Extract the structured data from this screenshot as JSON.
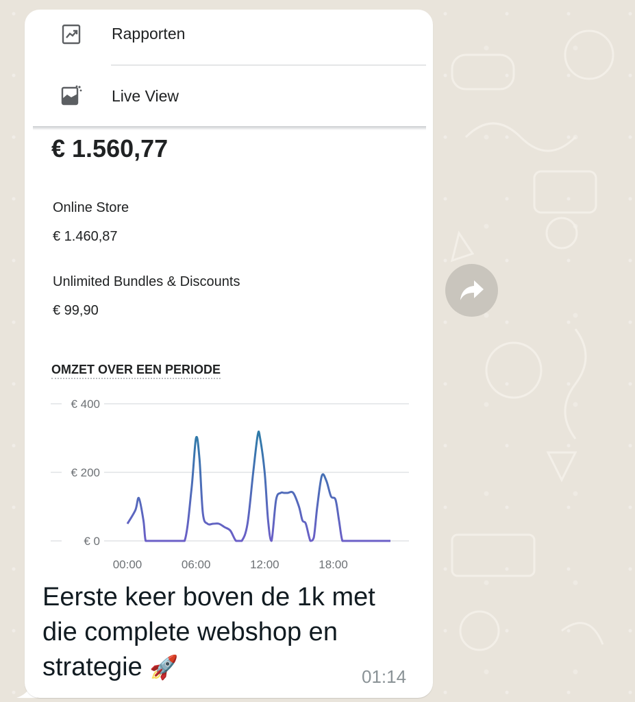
{
  "menu": {
    "items": [
      {
        "label": "Rapporten",
        "icon": "report-chart-icon"
      },
      {
        "label": "Live View",
        "icon": "live-view-icon"
      }
    ]
  },
  "summary": {
    "total": "€ 1.560,77",
    "sources": [
      {
        "name": "Online Store",
        "value": "€ 1.460,87"
      },
      {
        "name": "Unlimited Bundles & Discounts",
        "value": "€ 99,90"
      }
    ]
  },
  "chart_data": {
    "type": "line",
    "title": "OMZET OVER EEN PERIODE",
    "xlabel": "",
    "ylabel": "",
    "y_ticks": [
      "€ 0",
      "€ 200",
      "€ 400"
    ],
    "x_ticks": [
      "00:00",
      "06:00",
      "12:00",
      "18:00"
    ],
    "ylim": [
      0,
      400
    ],
    "xlim": [
      0,
      23
    ],
    "grid": true,
    "color": "#5c6ac4",
    "series": [
      {
        "x": [
          0,
          0.7,
          1.0,
          1.4,
          1.6,
          2,
          3,
          4,
          5,
          5.6,
          6.0,
          6.3,
          6.6,
          7,
          7.5,
          8,
          8.5,
          9,
          9.5,
          10,
          10.5,
          11,
          11.4,
          11.6,
          12.0,
          12.3,
          12.6,
          13,
          13.4,
          13.7,
          14,
          14.5,
          15,
          15.3,
          15.6,
          16,
          16.3,
          16.6,
          17,
          17.4,
          17.8,
          18.2,
          18.5,
          18.8,
          19.2,
          19.6,
          20,
          21,
          22,
          23
        ],
        "values": [
          50,
          90,
          125,
          60,
          0,
          0,
          0,
          0,
          0,
          150,
          300,
          240,
          80,
          50,
          50,
          50,
          40,
          30,
          0,
          0,
          50,
          200,
          310,
          300,
          200,
          60,
          0,
          120,
          140,
          140,
          140,
          140,
          100,
          60,
          50,
          0,
          10,
          100,
          190,
          175,
          130,
          120,
          60,
          0,
          0,
          0,
          0,
          0,
          0,
          0
        ]
      }
    ]
  },
  "message": {
    "caption": "Eerste keer boven de 1k met die complete webshop en strategie",
    "emoji": "🚀",
    "time": "01:14"
  },
  "forward": {
    "icon": "forward-arrow-icon"
  }
}
